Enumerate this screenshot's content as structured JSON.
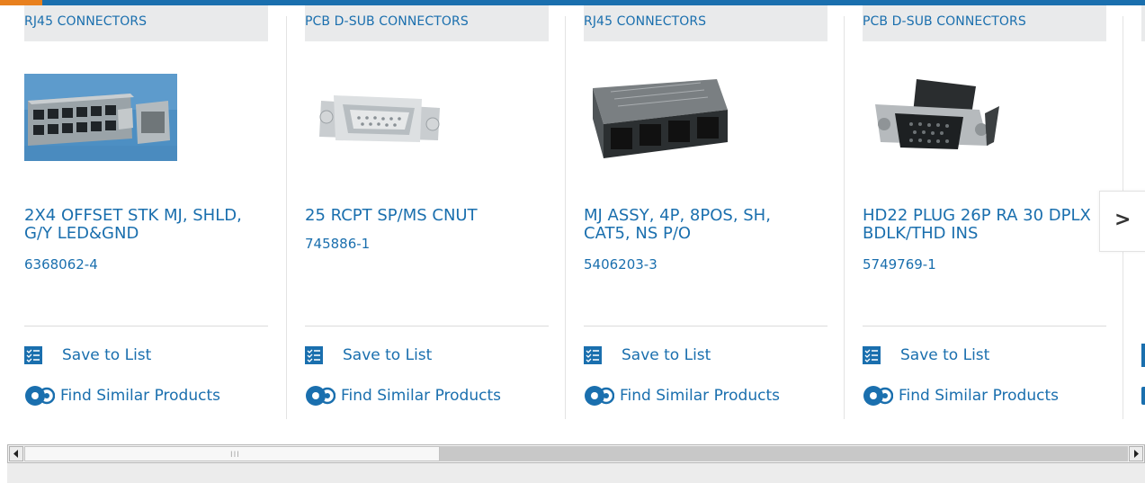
{
  "brand": {
    "primary": "#1a6fae",
    "accent": "#e8801e"
  },
  "cards": [
    {
      "category": "RJ45 CONNECTORS",
      "image": "rj45-2x4-stacked-jack-image",
      "title": "2X4 OFFSET STK MJ, SHLD, G/Y LED&GND",
      "part_number": "6368062-4",
      "save_label": "Save to List",
      "find_label": "Find Similar Products"
    },
    {
      "category": "PCB D-SUB CONNECTORS",
      "image": "d-sub-receptacle-image",
      "title": "25 RCPT SP/MS CNUT",
      "part_number": "745886-1",
      "save_label": "Save to List",
      "find_label": "Find Similar Products"
    },
    {
      "category": "RJ45 CONNECTORS",
      "image": "rj45-4-port-jack-image",
      "title": "MJ ASSY, 4P, 8POS, SH, CAT5, NS P/O",
      "part_number": "5406203-3",
      "save_label": "Save to List",
      "find_label": "Find Similar Products"
    },
    {
      "category": "PCB D-SUB CONNECTORS",
      "image": "hd22-plug-image",
      "title": "HD22 PLUG 26P RA 30 DPLX BDLK/THD INS",
      "part_number": "5749769-1",
      "save_label": "Save to List",
      "find_label": "Find Similar Products"
    }
  ],
  "carousel": {
    "next_icon": "chevron-right-icon",
    "next_glyph": ">"
  },
  "scrollbar": {
    "left_icon": "arrow-left-icon",
    "right_icon": "arrow-right-icon",
    "grip": "III",
    "position": 0.0
  }
}
